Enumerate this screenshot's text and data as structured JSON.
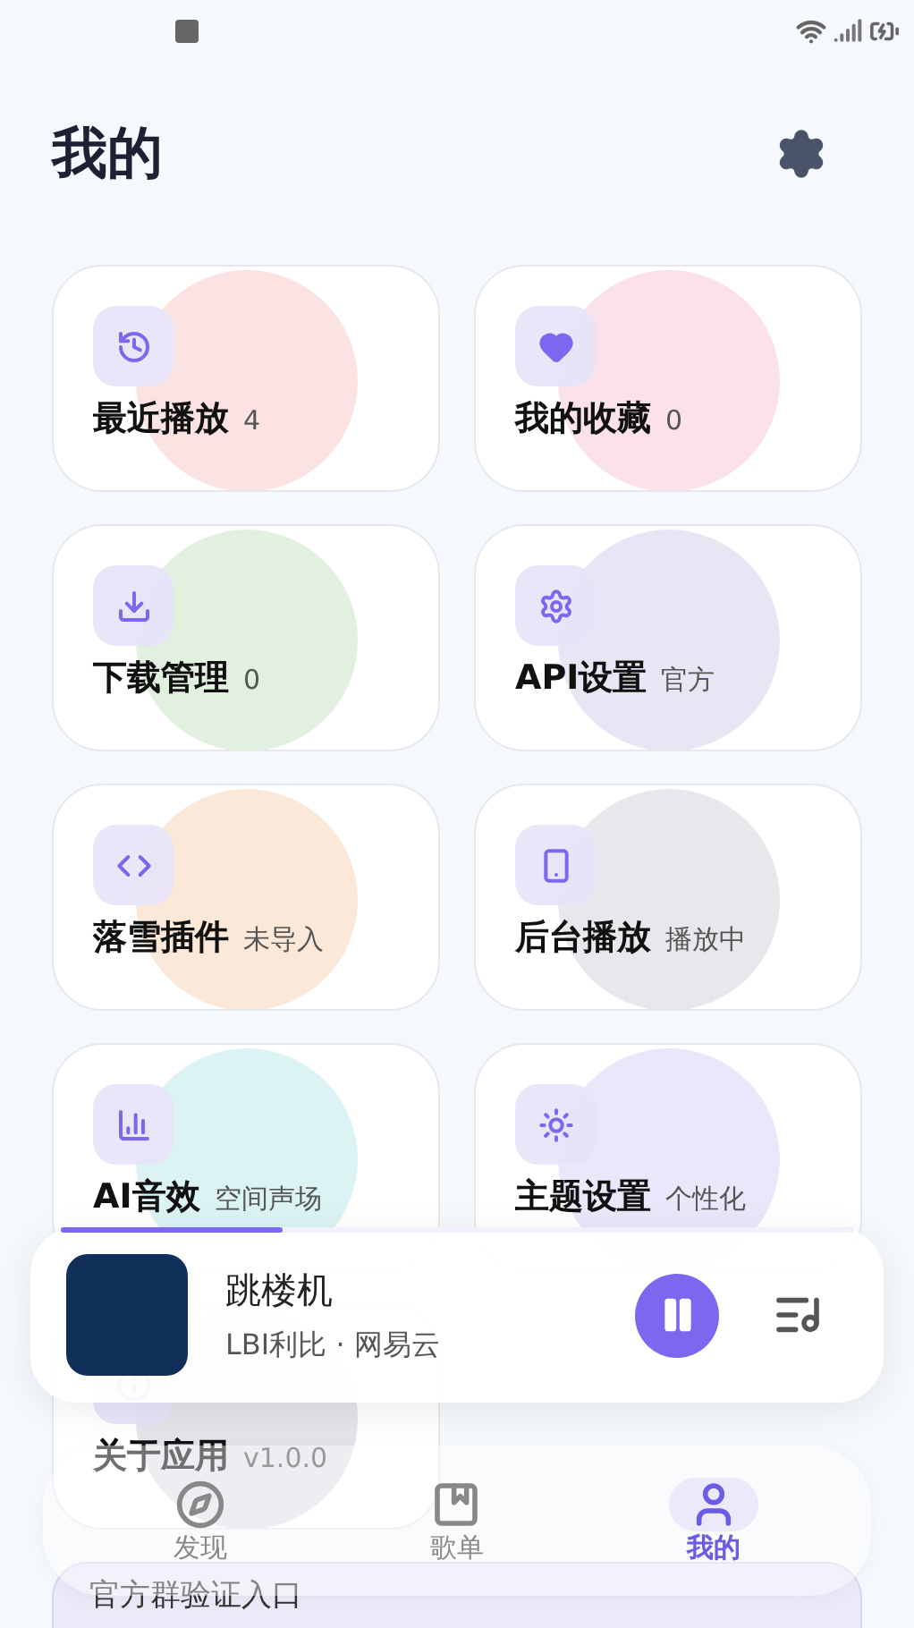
{
  "header": {
    "title": "我的"
  },
  "cards": [
    {
      "label": "最近播放",
      "detail": "4",
      "color": "#fbe3e3"
    },
    {
      "label": "我的收藏",
      "detail": "0",
      "color": "#fbe1ea"
    },
    {
      "label": "下载管理",
      "detail": "0",
      "color": "#e2f0e0"
    },
    {
      "label": "API设置",
      "detail": "官方",
      "color": "#e6e6f4"
    },
    {
      "label": "落雪插件",
      "detail": "未导入",
      "color": "#fbe8d8"
    },
    {
      "label": "后台播放",
      "detail": "播放中",
      "color": "#e8e8ec"
    },
    {
      "label": "AI音效",
      "detail": "空间声场",
      "color": "#dcf3f3"
    },
    {
      "label": "主题设置",
      "detail": "个性化",
      "color": "#ece6fa"
    },
    {
      "label": "关于应用",
      "detail": "v1.0.0",
      "color": "#e3e3ea"
    }
  ],
  "verify_entry": {
    "label": "官方群验证入口"
  },
  "player": {
    "title": "跳楼机",
    "subtitle": "LBI利比 · 网易云",
    "level": 0.28,
    "playing": true
  },
  "nav": [
    {
      "label": "发现",
      "selected": false
    },
    {
      "label": "歌单",
      "selected": false
    },
    {
      "label": "我的",
      "selected": true
    }
  ]
}
